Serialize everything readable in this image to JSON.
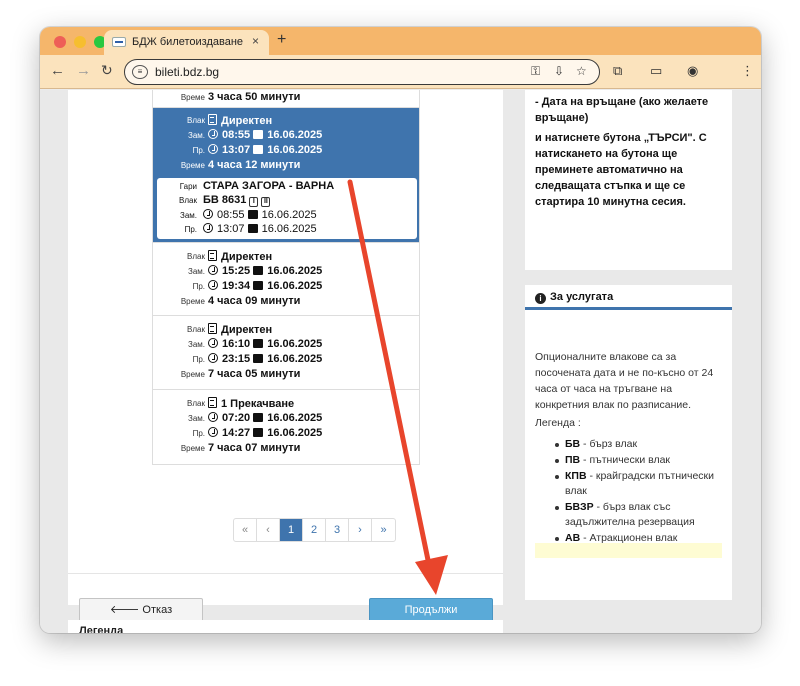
{
  "browser": {
    "tab_title": "БДЖ билетоиздаване",
    "tab_close": "×",
    "new_tab": "+",
    "url": "bileti.bdz.bg"
  },
  "itinerary": {
    "partial_top": {
      "label": "Време",
      "value": "3 часа 50 минути"
    },
    "selected": {
      "train_label": "Влак",
      "train": "Директен",
      "dep_label": "Зам.",
      "dep_time": "08:55",
      "dep_date": "16.06.2025",
      "arr_label": "Пр.",
      "arr_time": "13:07",
      "arr_date": "16.06.2025",
      "dur_label": "Време",
      "duration": "4 часа 12 минути",
      "detail": {
        "stations_label": "Гари",
        "stations": "СТАРА ЗАГОРА - ВАРНА",
        "train_label": "Влак",
        "train_no": "БВ 8631",
        "badge1": "I",
        "badge2": "II",
        "dep_label": "Зам.",
        "dep_time": "08:55",
        "dep_date": "16.06.2025",
        "arr_label": "Пр.",
        "arr_time": "13:07",
        "arr_date": "16.06.2025"
      }
    },
    "options": [
      {
        "train_label": "Влак",
        "train": "Директен",
        "dep_label": "Зам.",
        "dep_time": "15:25",
        "dep_date": "16.06.2025",
        "arr_label": "Пр.",
        "arr_time": "19:34",
        "arr_date": "16.06.2025",
        "dur_label": "Време",
        "duration": "4 часа 09 минути"
      },
      {
        "train_label": "Влак",
        "train": "Директен",
        "dep_label": "Зам.",
        "dep_time": "16:10",
        "dep_date": "16.06.2025",
        "arr_label": "Пр.",
        "arr_time": "23:15",
        "arr_date": "16.06.2025",
        "dur_label": "Време",
        "duration": "7 часа 05 минути"
      },
      {
        "train_label": "Влак",
        "train": "1 Прекачване",
        "dep_label": "Зам.",
        "dep_time": "07:20",
        "dep_date": "16.06.2025",
        "arr_label": "Пр.",
        "arr_time": "14:27",
        "arr_date": "16.06.2025",
        "dur_label": "Време",
        "duration": "7 часа 07 минути"
      }
    ]
  },
  "pagination": {
    "first": "«",
    "prev": "‹",
    "p1": "1",
    "p2": "2",
    "p3": "3",
    "next": "›",
    "last": "»",
    "current": 1
  },
  "actions": {
    "cancel": "🡐 Отказ",
    "next": "Продължи"
  },
  "legend_title": "Легенда",
  "instructions": {
    "line1": "- Дата на връщане (ако желаете връщане)",
    "line2": "и натиснете бутона „ТЪРСИ\". С натискането на бутона ще преминете автоматично на следващата стъпка и ще се стартира 10 минутна сесия."
  },
  "service": {
    "title": "За услугата",
    "text": "Опционалните влакове са за посочената дата и не по-късно от 24 часа от часа на тръгване на конкретния влак по разписание.",
    "legend": "Легенда :",
    "items": [
      {
        "code": "БВ",
        "desc": " - бърз влак"
      },
      {
        "code": "ПВ",
        "desc": " - пътнически влак"
      },
      {
        "code": "КПВ",
        "desc": " - крайградски пътнически влак"
      },
      {
        "code": "БВЗР",
        "desc": " - бърз влак със задължителна резервация"
      },
      {
        "code": "АВ",
        "desc": " - Атракционен влак"
      }
    ]
  },
  "colors": {
    "accent": "#3f74ad",
    "next_button": "#5aaad8",
    "annotation_arrow": "#e8452c",
    "chrome_tabbar": "#f5b66b"
  }
}
